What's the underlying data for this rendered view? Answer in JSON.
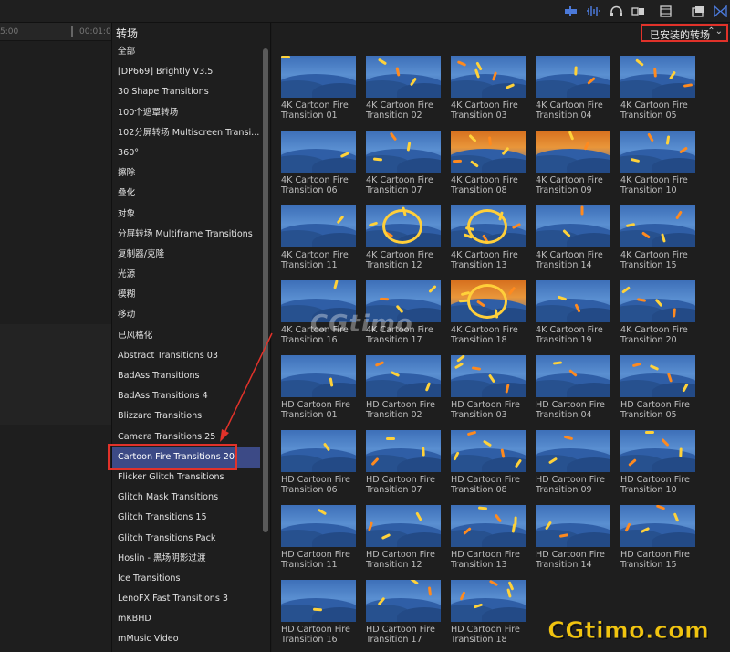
{
  "toolbar": {
    "icons": [
      "clip-appearance-icon",
      "audio-wave-icon",
      "headphones-icon",
      "solo-icon",
      "filmstrip-icon",
      "window-icon",
      "browser-toggle-icon"
    ]
  },
  "timeline": {
    "timecode_start": "5:00",
    "timecode_end": "00:01:0"
  },
  "sidebar": {
    "title": "转场",
    "items": [
      "全部",
      "[DP669] Brightly V3.5",
      "30 Shape Transitions",
      "100个遮罩转场",
      "102分屏转场 Multiscreen Transi...",
      "360°",
      "擦除",
      "叠化",
      "对象",
      "分屏转场 Multiframe Transitions",
      "复制器/克隆",
      "光源",
      "模糊",
      "移动",
      "已风格化",
      "Abstract Transitions 03",
      "BadAss Transitions",
      "BadAss Transitions 4",
      "Blizzard Transitions",
      "Camera Transitions 25",
      "Cartoon Fire Transitions 20",
      "Flicker Glitch Transitions",
      "Glitch Mask Transitions",
      "Glitch Transitions 15",
      "Glitch Transitions Pack",
      "Hoslin - 黑场阴影过渡",
      "Ice Transitions",
      "LenoFX Fast Transitions 3",
      "mKBHD",
      "mMusic Video"
    ],
    "selected_index": 20
  },
  "browser": {
    "filter_label": "已安装的转场",
    "tiles": [
      {
        "line1": "4K Cartoon Fire",
        "line2": "Transition 01"
      },
      {
        "line1": "4K Cartoon Fire",
        "line2": "Transition 02"
      },
      {
        "line1": "4K Cartoon Fire",
        "line2": "Transition 03"
      },
      {
        "line1": "4K Cartoon Fire",
        "line2": "Transition 04"
      },
      {
        "line1": "4K Cartoon Fire",
        "line2": "Transition 05"
      },
      {
        "line1": "4K Cartoon Fire",
        "line2": "Transition 06"
      },
      {
        "line1": "4K Cartoon Fire",
        "line2": "Transition 07"
      },
      {
        "line1": "4K Cartoon Fire",
        "line2": "Transition 08"
      },
      {
        "line1": "4K Cartoon Fire",
        "line2": "Transition 09"
      },
      {
        "line1": "4K Cartoon Fire",
        "line2": "Transition 10"
      },
      {
        "line1": "4K Cartoon Fire",
        "line2": "Transition 11"
      },
      {
        "line1": "4K Cartoon Fire",
        "line2": "Transition 12"
      },
      {
        "line1": "4K Cartoon Fire",
        "line2": "Transition 13"
      },
      {
        "line1": "4K Cartoon Fire",
        "line2": "Transition 14"
      },
      {
        "line1": "4K Cartoon Fire",
        "line2": "Transition 15"
      },
      {
        "line1": "4K Cartoon Fire",
        "line2": "Transition 16"
      },
      {
        "line1": "4K Cartoon Fire",
        "line2": "Transition 17"
      },
      {
        "line1": "4K Cartoon Fire",
        "line2": "Transition 18"
      },
      {
        "line1": "4K Cartoon Fire",
        "line2": "Transition 19"
      },
      {
        "line1": "4K Cartoon Fire",
        "line2": "Transition 20"
      },
      {
        "line1": "HD Cartoon Fire",
        "line2": "Transition 01"
      },
      {
        "line1": "HD Cartoon Fire",
        "line2": "Transition 02"
      },
      {
        "line1": "HD Cartoon Fire",
        "line2": "Transition 03"
      },
      {
        "line1": "HD Cartoon Fire",
        "line2": "Transition 04"
      },
      {
        "line1": "HD Cartoon Fire",
        "line2": "Transition 05"
      },
      {
        "line1": "HD Cartoon Fire",
        "line2": "Transition 06"
      },
      {
        "line1": "HD Cartoon Fire",
        "line2": "Transition 07"
      },
      {
        "line1": "HD Cartoon Fire",
        "line2": "Transition 08"
      },
      {
        "line1": "HD Cartoon Fire",
        "line2": "Transition 09"
      },
      {
        "line1": "HD Cartoon Fire",
        "line2": "Transition 10"
      },
      {
        "line1": "HD Cartoon Fire",
        "line2": "Transition 11"
      },
      {
        "line1": "HD Cartoon Fire",
        "line2": "Transition 12"
      },
      {
        "line1": "HD Cartoon Fire",
        "line2": "Transition 13"
      },
      {
        "line1": "HD Cartoon Fire",
        "line2": "Transition 14"
      },
      {
        "line1": "HD Cartoon Fire",
        "line2": "Transition 15"
      },
      {
        "line1": "HD Cartoon Fire",
        "line2": "Transition 16"
      },
      {
        "line1": "HD Cartoon Fire",
        "line2": "Transition 17"
      },
      {
        "line1": "HD Cartoon Fire",
        "line2": "Transition 18"
      }
    ]
  },
  "watermark": {
    "overlay_text": "CGtimo",
    "corner_text": "CGtimo.com"
  },
  "colors": {
    "selection": "#3c4a86",
    "highlight_box": "#e1322a",
    "watermark": "#f1c40f"
  }
}
